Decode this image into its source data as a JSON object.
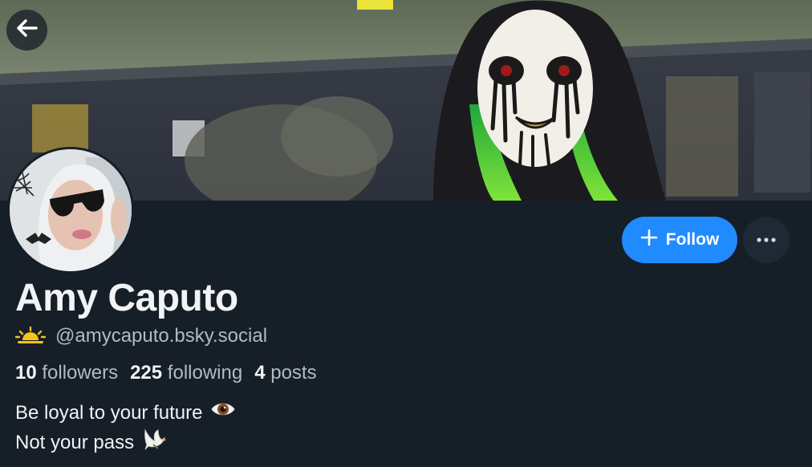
{
  "profile": {
    "display_name": "Amy Caputo",
    "handle": "@amycaputo.bsky.social",
    "stats": {
      "followers_count": "10",
      "followers_label": "followers",
      "following_count": "225",
      "following_label": "following",
      "posts_count": "4",
      "posts_label": "posts"
    },
    "bio": {
      "line1": "Be loyal to your future",
      "line2": "Not your pass"
    }
  },
  "actions": {
    "follow_label": "Follow"
  },
  "icons": {
    "back": "arrow-left-icon",
    "follow": "plus-icon",
    "more": "ellipsis-icon",
    "handle_badge": "sunrise-icon",
    "bio_emoji_1": "eye-emoji",
    "bio_emoji_2": "dove-emoji"
  },
  "colors": {
    "background": "#161e27",
    "accent": "#208bfe",
    "secondary_text": "#aebbc9"
  }
}
